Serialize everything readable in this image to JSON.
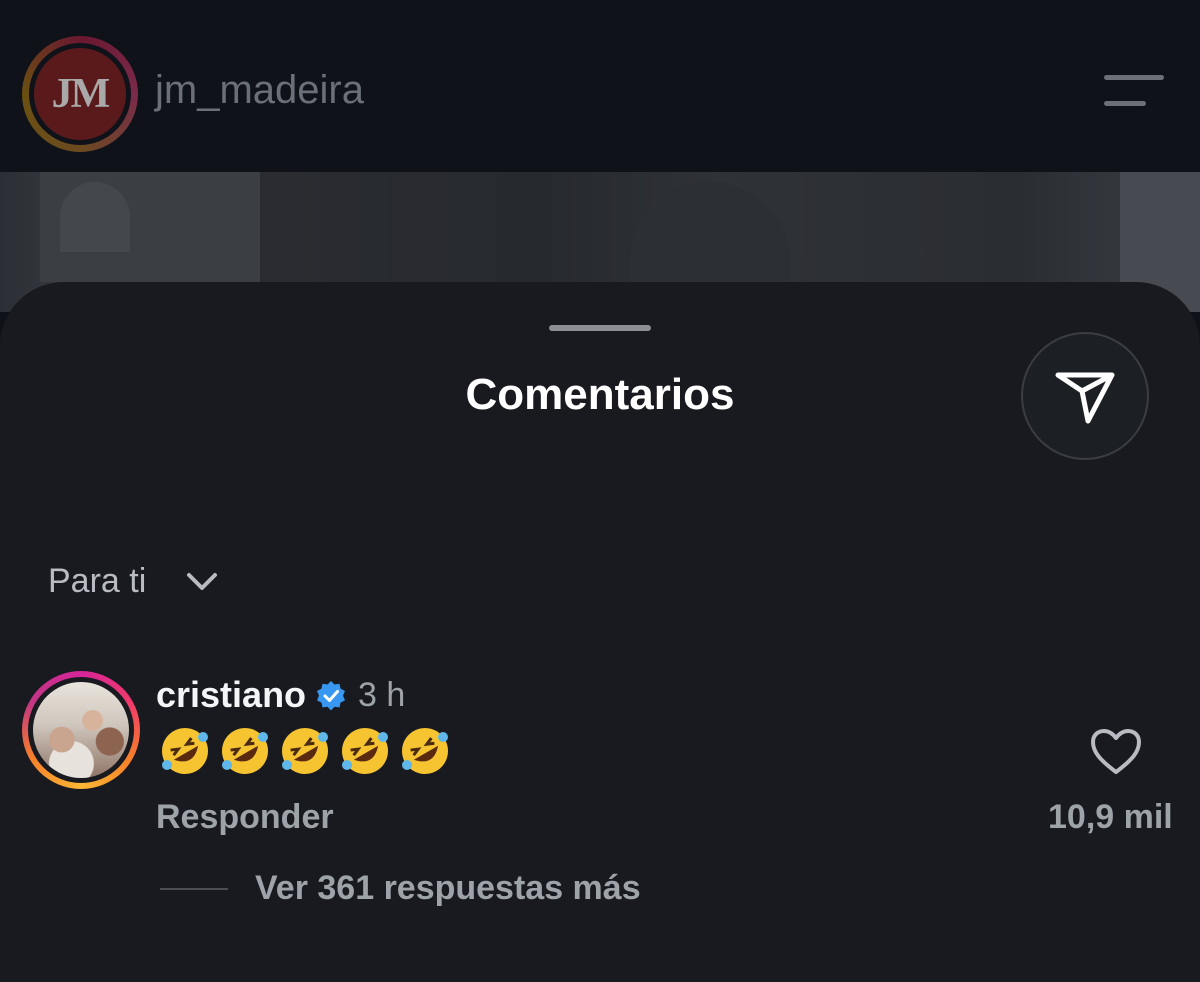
{
  "header": {
    "username": "jm_madeira",
    "logo_text": "JM"
  },
  "sheet": {
    "title": "Comentarios"
  },
  "sort": {
    "label": "Para ti"
  },
  "comment": {
    "username": "cristiano",
    "time": "3 h",
    "emoji_count": 5,
    "reply_label": "Responder",
    "like_count": "10,9 mil",
    "more_replies": "Ver 361 respuestas más"
  },
  "colors": {
    "verified": "#3897f0",
    "accent_ring": "#d6259a"
  }
}
